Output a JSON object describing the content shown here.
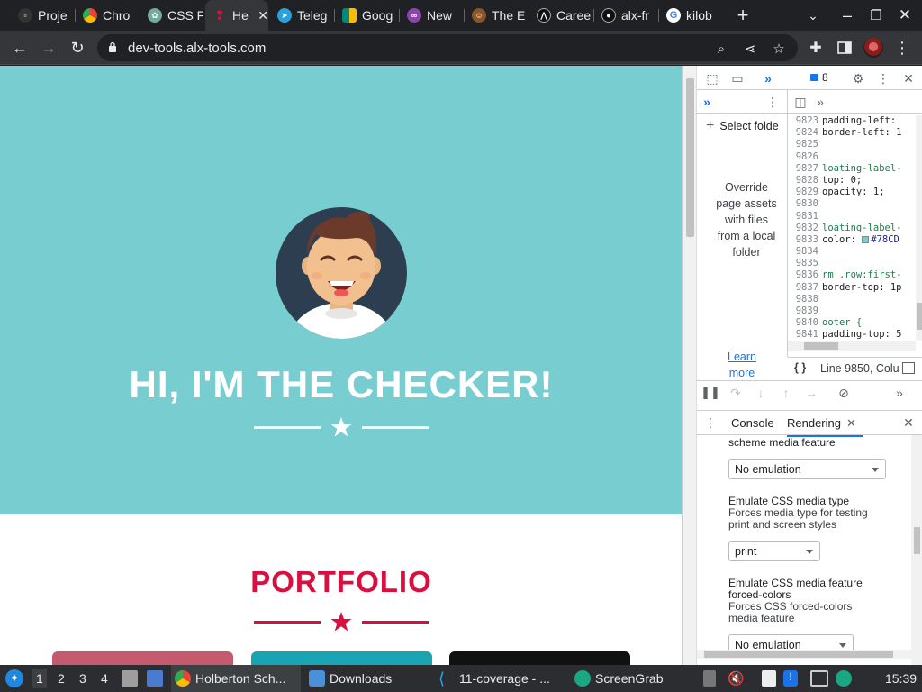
{
  "browser": {
    "tabs": [
      {
        "title": "Proje",
        "icon": "project-favicon",
        "color": "#333333"
      },
      {
        "title": "Chro",
        "icon": "chrome-favicon",
        "color": "#4285f4"
      },
      {
        "title": "CSS F",
        "icon": "chatgpt-favicon",
        "color": "#74aa9c"
      },
      {
        "title": "He",
        "icon": "holberton-favicon",
        "color": "#d9103f",
        "active": true
      },
      {
        "title": "Teleg",
        "icon": "telegram-favicon",
        "color": "#2aa1da"
      },
      {
        "title": "Goog",
        "icon": "google-meet-favicon",
        "color": "#00897b"
      },
      {
        "title": "New",
        "icon": "new-tab-favicon",
        "color": "#8e44ad"
      },
      {
        "title": "The E",
        "icon": "avatar-favicon",
        "color": "#8d5524"
      },
      {
        "title": "Caree",
        "icon": "career-favicon",
        "color": "#111111"
      },
      {
        "title": "alx-fr",
        "icon": "github-favicon",
        "color": "#111111"
      },
      {
        "title": "kilob",
        "icon": "google-favicon",
        "color": "#ffffff"
      }
    ],
    "url": "dev-tools.alx-tools.com"
  },
  "page": {
    "hero_title": "HI, I'M THE CHECKER!",
    "portfolio_title": "PORTFOLIO",
    "colors": {
      "hero_bg": "#78cdd1",
      "accent": "#d9103f",
      "card1": "#c35a6e",
      "card2": "#1aa3b0",
      "card3": "#111111"
    }
  },
  "devtools": {
    "issues_count": "8",
    "select_folder": "Select folde",
    "override_text": "Override page assets with files from a local folder",
    "learn_more": "Learn more",
    "code_lines": [
      {
        "n": "9823",
        "t": "padding-left: ",
        "k": "prop"
      },
      {
        "n": "9824",
        "t": "border-left: 1",
        "k": "prop"
      },
      {
        "n": "9825",
        "t": "",
        "k": "prop"
      },
      {
        "n": "9826",
        "t": "",
        "k": "prop"
      },
      {
        "n": "9827",
        "t": "loating-label-",
        "k": "sel"
      },
      {
        "n": "9828",
        "t": "top: 0;",
        "k": "prop"
      },
      {
        "n": "9829",
        "t": "opacity: 1;",
        "k": "prop"
      },
      {
        "n": "9830",
        "t": "",
        "k": "prop"
      },
      {
        "n": "9831",
        "t": "",
        "k": "prop"
      },
      {
        "n": "9832",
        "t": "loating-label-",
        "k": "sel"
      },
      {
        "n": "9833",
        "t": "color: ",
        "k": "prop",
        "swatch": "#78CD"
      },
      {
        "n": "9834",
        "t": "",
        "k": "prop"
      },
      {
        "n": "9835",
        "t": "",
        "k": "prop"
      },
      {
        "n": "9836",
        "t": "rm .row:first-",
        "k": "sel"
      },
      {
        "n": "9837",
        "t": "border-top: 1p",
        "k": "prop"
      },
      {
        "n": "9838",
        "t": "",
        "k": "prop"
      },
      {
        "n": "9839",
        "t": "",
        "k": "prop"
      },
      {
        "n": "9840",
        "t": "ooter {",
        "k": "sel"
      },
      {
        "n": "9841",
        "t": "padding-top: 5",
        "k": "prop"
      }
    ],
    "status_text": "Line 9850, Colu",
    "drawer": {
      "console_label": "Console",
      "rendering_label": "Rendering"
    },
    "rendering": {
      "scheme_tail": "scheme media feature",
      "scheme_value": "No emulation",
      "media_type_title": "Emulate CSS media type",
      "media_type_desc1": "Forces media type for testing",
      "media_type_desc2": "print and screen styles",
      "media_type_value": "print",
      "forced_title1": "Emulate CSS media feature",
      "forced_title2": "forced-colors",
      "forced_desc1": "Forces CSS forced-colors",
      "forced_desc2": "media feature",
      "forced_value": "No emulation"
    }
  },
  "taskbar": {
    "workspaces": [
      "1",
      "2",
      "3",
      "4"
    ],
    "tasks": [
      {
        "label": "Holberton Sch...",
        "icon": "chrome-icon",
        "color": "#4285f4"
      },
      {
        "label": "Downloads",
        "icon": "folder-icon",
        "color": "#4a90d9"
      },
      {
        "label": "11-coverage - ...",
        "icon": "vscode-icon",
        "color": "#23a9f2"
      },
      {
        "label": "ScreenGrab",
        "icon": "screengrab-icon",
        "color": "#1ba784"
      }
    ],
    "clock": "15:39"
  }
}
